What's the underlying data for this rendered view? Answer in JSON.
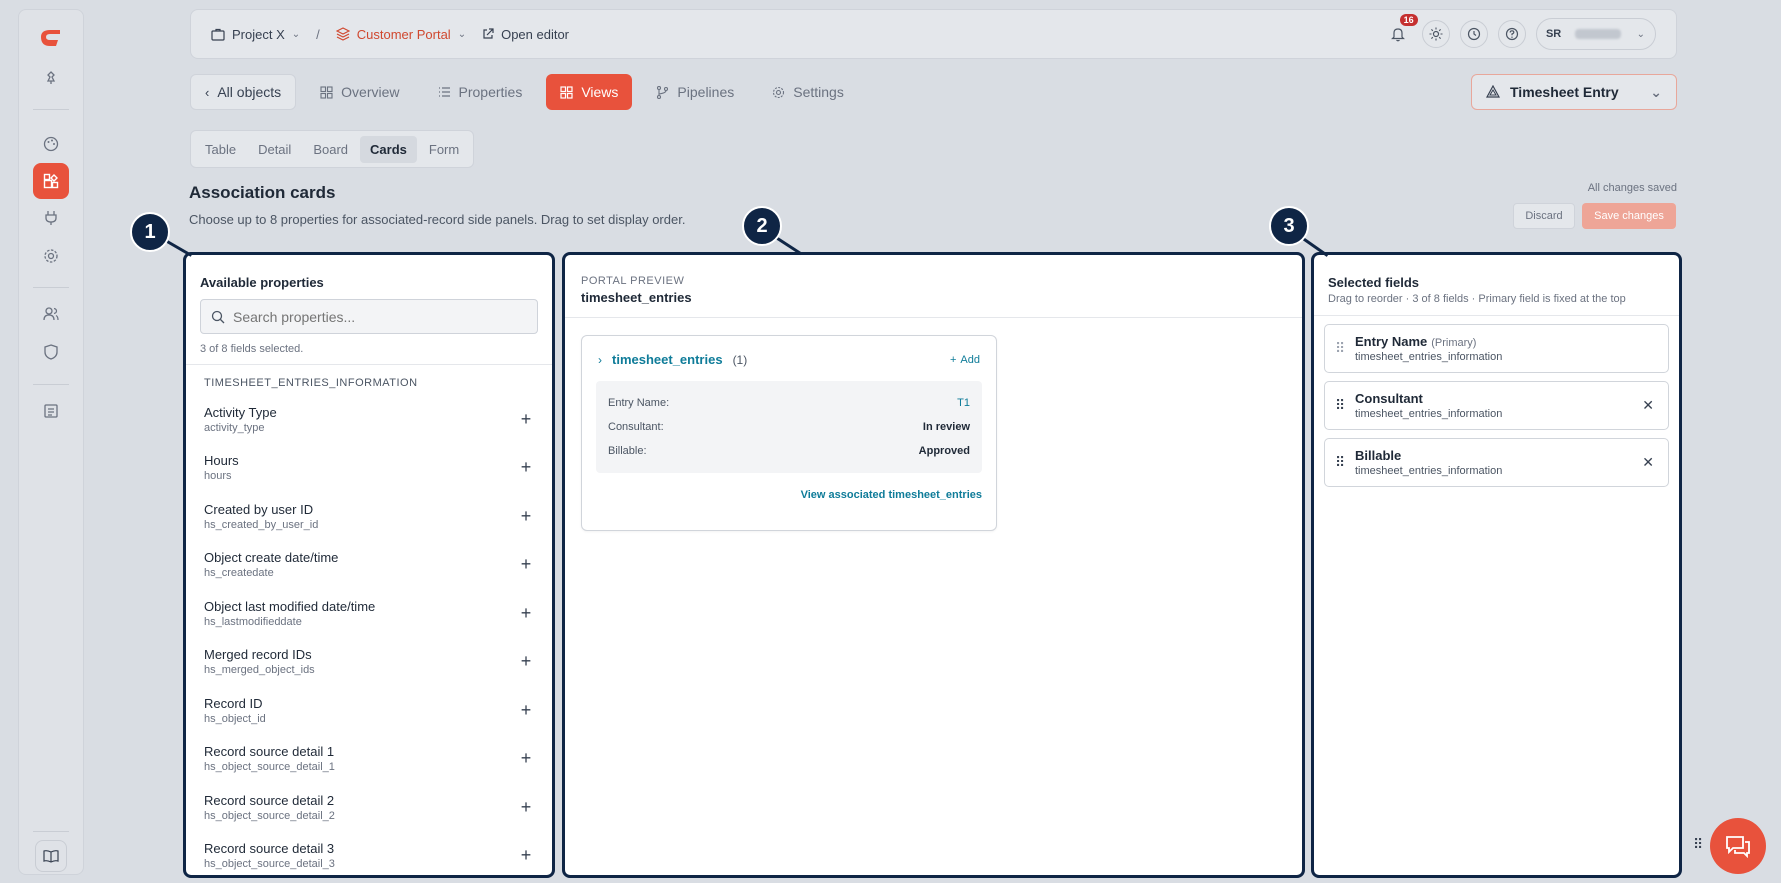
{
  "topbar": {
    "project": "Project X",
    "portal": "Customer Portal",
    "open_editor": "Open editor",
    "notification_count": "16",
    "user_initials": "SR"
  },
  "nav": {
    "back": "All objects",
    "tabs": [
      {
        "label": "Overview",
        "icon": "grid-icon"
      },
      {
        "label": "Properties",
        "icon": "list-icon"
      },
      {
        "label": "Views",
        "icon": "grid-icon",
        "active": true
      },
      {
        "label": "Pipelines",
        "icon": "branch-icon"
      },
      {
        "label": "Settings",
        "icon": "gear-icon"
      }
    ],
    "entity": "Timesheet Entry"
  },
  "subtabs": [
    "Table",
    "Detail",
    "Board",
    "Cards",
    "Form"
  ],
  "page": {
    "title": "Association cards",
    "subtitle": "Choose up to 8 properties for associated-record side panels. Drag to set display order.",
    "saved": "All changes saved",
    "discard": "Discard",
    "save": "Save changes"
  },
  "callouts": [
    "1",
    "2",
    "3"
  ],
  "available": {
    "heading": "Available properties",
    "search_placeholder": "Search properties...",
    "count": "3 of 8 fields selected.",
    "group": "TIMESHEET_ENTRIES_INFORMATION",
    "items": [
      {
        "name": "Activity Type",
        "key": "activity_type"
      },
      {
        "name": "Hours",
        "key": "hours"
      },
      {
        "name": "Created by user ID",
        "key": "hs_created_by_user_id"
      },
      {
        "name": "Object create date/time",
        "key": "hs_createdate"
      },
      {
        "name": "Object last modified date/time",
        "key": "hs_lastmodifieddate"
      },
      {
        "name": "Merged record IDs",
        "key": "hs_merged_object_ids"
      },
      {
        "name": "Record ID",
        "key": "hs_object_id"
      },
      {
        "name": "Record source detail 1",
        "key": "hs_object_source_detail_1"
      },
      {
        "name": "Record source detail 2",
        "key": "hs_object_source_detail_2"
      },
      {
        "name": "Record source detail 3",
        "key": "hs_object_source_detail_3"
      }
    ]
  },
  "preview": {
    "eyebrow": "PORTAL PREVIEW",
    "title": "timesheet_entries",
    "card": {
      "title": "timesheet_entries",
      "count": "(1)",
      "add": "Add",
      "rows": [
        {
          "k": "Entry Name:",
          "v": "T1"
        },
        {
          "k": "Consultant:",
          "v": "In review"
        },
        {
          "k": "Billable:",
          "v": "Approved"
        }
      ],
      "footer": "View associated timesheet_entries"
    }
  },
  "selected": {
    "heading": "Selected fields",
    "hint": "Drag to reorder · 3 of 8 fields · Primary field is fixed at the top",
    "items": [
      {
        "name": "Entry Name",
        "tag": "(Primary)",
        "key": "timesheet_entries_information"
      },
      {
        "name": "Consultant",
        "tag": "",
        "key": "timesheet_entries_information"
      },
      {
        "name": "Billable",
        "tag": "",
        "key": "timesheet_entries_information"
      }
    ]
  },
  "colors": {
    "accent": "#e8523c",
    "navy": "#0f2545",
    "link": "#0f7c99"
  }
}
